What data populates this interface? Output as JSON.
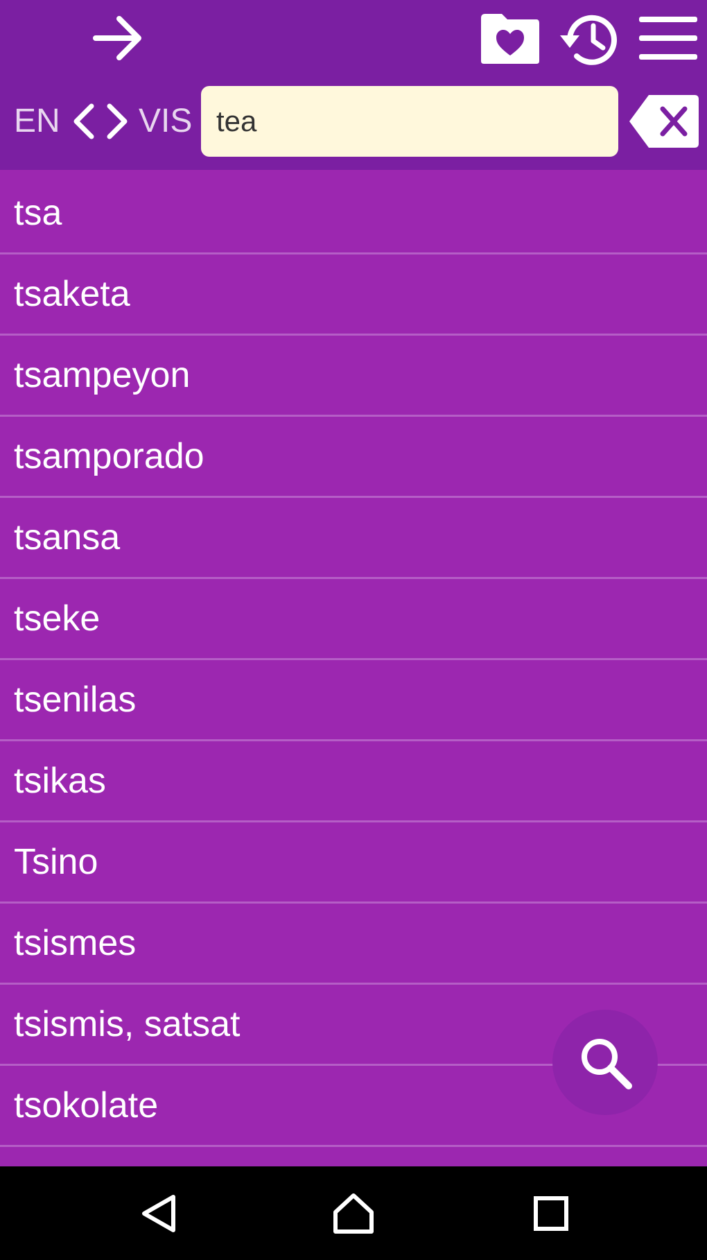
{
  "colors": {
    "toolbar_bg": "#7b1fa2",
    "list_bg": "#9c27b0",
    "divider": "#b55ec6",
    "search_bg": "#fff8dc",
    "fab_bg": "#8e24aa",
    "nav_bg": "#000000",
    "icon": "#ffffff"
  },
  "toolbar": {
    "icons": [
      "arrow-right-icon",
      "favorites-folder-icon",
      "history-icon",
      "menu-icon"
    ],
    "source_lang": "EN",
    "target_lang": "VIS",
    "swap_icons": [
      "chevron-left-icon",
      "chevron-right-icon"
    ],
    "clear_icon": "backspace-clear-icon"
  },
  "search": {
    "value": "tea",
    "placeholder": ""
  },
  "results": [
    "tsa",
    "tsaketa",
    "tsampeyon",
    "tsamporado",
    "tsansa",
    "tseke",
    "tsenilas",
    "tsikas",
    "Tsino",
    "tsismes",
    "tsismis, satsat",
    "tsokolate"
  ],
  "fab": {
    "icon": "search-icon"
  },
  "navbar": {
    "icons": [
      "back-triangle-icon",
      "home-icon",
      "recents-square-icon"
    ]
  }
}
